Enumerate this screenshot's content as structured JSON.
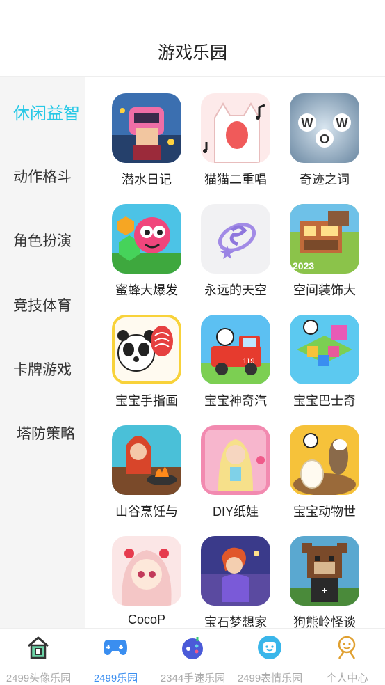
{
  "header": {
    "title": "游戏乐园"
  },
  "sidebar": {
    "items": [
      {
        "label": "休闲益智",
        "active": true
      },
      {
        "label": "动作格斗",
        "active": false
      },
      {
        "label": "角色扮演",
        "active": false
      },
      {
        "label": "竞技体育",
        "active": false
      },
      {
        "label": "卡牌游戏",
        "active": false
      },
      {
        "label": "塔防策略",
        "active": false
      }
    ]
  },
  "games": [
    {
      "label": "潜水日记",
      "icon": "diving-diary-icon"
    },
    {
      "label": "猫猫二重唱",
      "icon": "cat-duet-icon"
    },
    {
      "label": "奇迹之词",
      "icon": "wow-words-icon"
    },
    {
      "label": "蜜蜂大爆发",
      "icon": "bee-burst-icon"
    },
    {
      "label": "永远的天空",
      "icon": "eternal-sky-icon"
    },
    {
      "label": "空间装饰大",
      "icon": "home-design-icon"
    },
    {
      "label": "宝宝手指画",
      "icon": "baby-finger-paint-icon"
    },
    {
      "label": "宝宝神奇汽",
      "icon": "baby-fire-truck-icon"
    },
    {
      "label": "宝宝巴士奇",
      "icon": "baby-bus-puzzle-icon"
    },
    {
      "label": "山谷烹饪与",
      "icon": "valley-cooking-icon"
    },
    {
      "label": "DIY纸娃",
      "icon": "diy-paper-doll-icon"
    },
    {
      "label": "宝宝动物世",
      "icon": "baby-animal-world-icon"
    },
    {
      "label": "CocoP",
      "icon": "coco-anime-girl-icon"
    },
    {
      "label": "宝石梦想家",
      "icon": "gem-dreamer-icon"
    },
    {
      "label": "狗熊岭怪谈",
      "icon": "bear-ridge-icon"
    }
  ],
  "tabbar": {
    "items": [
      {
        "label": "2499头像乐园",
        "icon": "house-icon",
        "active": false
      },
      {
        "label": "2499乐园",
        "icon": "gamepad-icon",
        "active": true
      },
      {
        "label": "2344手速乐园",
        "icon": "joystick-icon",
        "active": false
      },
      {
        "label": "2499表情乐园",
        "icon": "emoji-icon",
        "active": false
      },
      {
        "label": "个人中心",
        "icon": "profile-icon",
        "active": false
      }
    ]
  },
  "colors": {
    "accent": "#27c8e6",
    "tab_active": "#3a8ef0",
    "tab_inactive": "#aaaaaa",
    "sidebar_bg": "#f5f5f5"
  }
}
